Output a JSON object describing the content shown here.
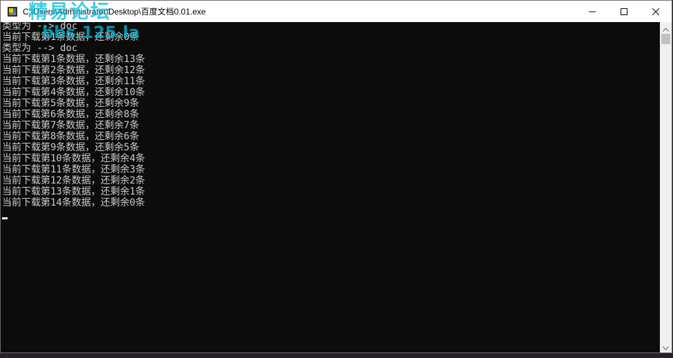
{
  "window": {
    "title": "C:\\Users\\Administrator\\Desktop\\百度文档0.01.exe",
    "icon": "console-app-icon"
  },
  "caption_buttons": {
    "minimize_icon": "minimize-icon",
    "maximize_icon": "maximize-icon",
    "close_icon": "close-icon"
  },
  "console": {
    "lines": [
      "类型为 --> doc",
      "当前下载第1条数据，还剩余0条",
      "类型为 --> doc",
      "当前下载第1条数据，还剩余13条",
      "当前下载第2条数据，还剩余12条",
      "当前下载第3条数据，还剩余11条",
      "当前下载第4条数据，还剩余10条",
      "当前下载第5条数据，还剩余9条",
      "当前下载第6条数据，还剩余8条",
      "当前下载第7条数据，还剩余7条",
      "当前下载第8条数据，还剩余6条",
      "当前下载第9条数据，还剩余5条",
      "当前下载第10条数据，还剩余4条",
      "当前下载第11条数据，还剩余3条",
      "当前下载第12条数据，还剩余2条",
      "当前下载第13条数据，还剩余1条",
      "当前下载第14条数据，还剩余0条"
    ],
    "text_color": "#cccccc",
    "background": "#0c0c0c"
  },
  "watermark": {
    "line1": "精易论坛",
    "line2": "bbs.125.la"
  }
}
